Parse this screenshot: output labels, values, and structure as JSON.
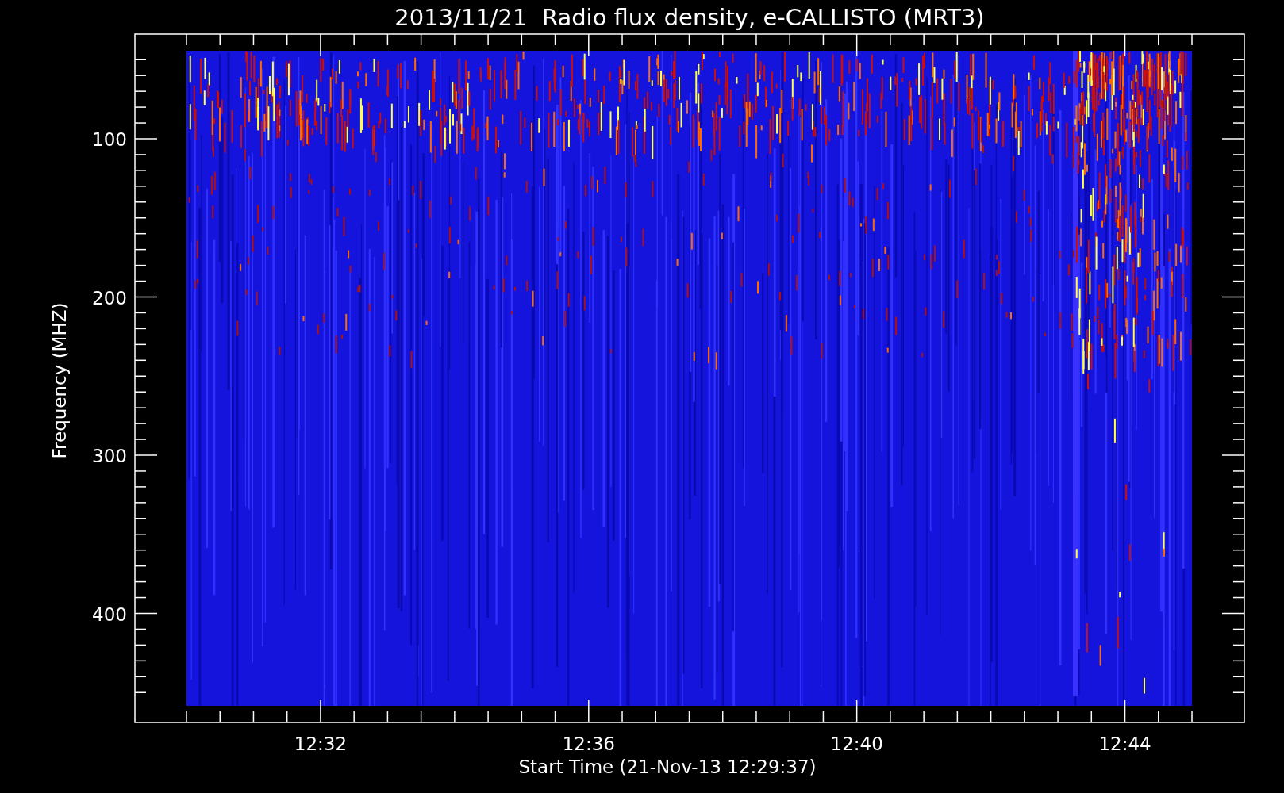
{
  "title": "2013/11/21  Radio flux density, e-CALLISTO (MRT3)",
  "y_axis": {
    "label": "Frequency (MHZ)",
    "ticks": [
      "100",
      "200",
      "300",
      "400"
    ]
  },
  "x_axis": {
    "label": "Start Time (21-Nov-13 12:29:37)",
    "ticks": [
      "12:32",
      "12:36",
      "12:40",
      "12:44"
    ]
  }
}
